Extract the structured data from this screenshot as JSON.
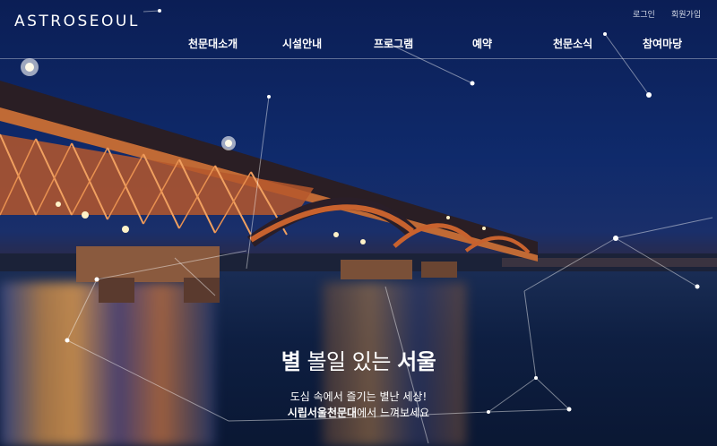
{
  "header": {
    "logo": "ASTROSEOUL",
    "util_links": {
      "login": "로그인",
      "signup": "회원가입"
    },
    "nav": [
      "천문대소개",
      "시설안내",
      "프로그램",
      "예약",
      "천문소식",
      "참여마당"
    ]
  },
  "hero": {
    "headline": {
      "part1": "별",
      "part2": " 볼일 있는 ",
      "part3": "서울"
    },
    "sub_line1": "도심 속에서 즐기는 별난 세상!",
    "sub_line2": {
      "bold": "시립서울천문대",
      "rest": "에서 느껴보세요"
    }
  },
  "colors": {
    "sky": "#0f2a6b",
    "bridge_light": "#e8873a",
    "text": "#ffffff"
  }
}
